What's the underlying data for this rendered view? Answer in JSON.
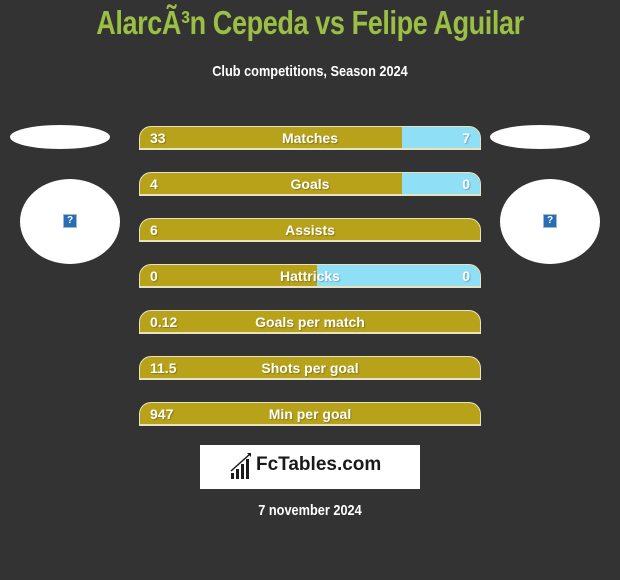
{
  "header": {
    "title": "AlarcÃ³n Cepeda vs Felipe Aguilar",
    "subtitle": "Club competitions, Season 2024"
  },
  "players": {
    "left": {
      "image_icon": "broken-image-icon",
      "icon_glyph": "?"
    },
    "right": {
      "image_icon": "broken-image-icon",
      "icon_glyph": "?"
    }
  },
  "colors": {
    "title": "#9bbe45",
    "left_bar": "#b8a21a",
    "right_bar": "#8fe0f7",
    "background": "#333333"
  },
  "stats": [
    {
      "label": "Matches",
      "left": "33",
      "right": "7",
      "left_share": 0.77
    },
    {
      "label": "Goals",
      "left": "4",
      "right": "0",
      "left_share": 0.77
    },
    {
      "label": "Assists",
      "left": "6",
      "right": "",
      "left_share": 1.0
    },
    {
      "label": "Hattricks",
      "left": "0",
      "right": "0",
      "left_share": 0.52
    },
    {
      "label": "Goals per match",
      "left": "0.12",
      "right": "",
      "left_share": 1.0
    },
    {
      "label": "Shots per goal",
      "left": "11.5",
      "right": "",
      "left_share": 1.0
    },
    {
      "label": "Min per goal",
      "left": "947",
      "right": "",
      "left_share": 1.0
    }
  ],
  "logo": {
    "text": "FcTables.com",
    "icon": "bar-chart-icon"
  },
  "footer": {
    "date": "7 november 2024"
  }
}
